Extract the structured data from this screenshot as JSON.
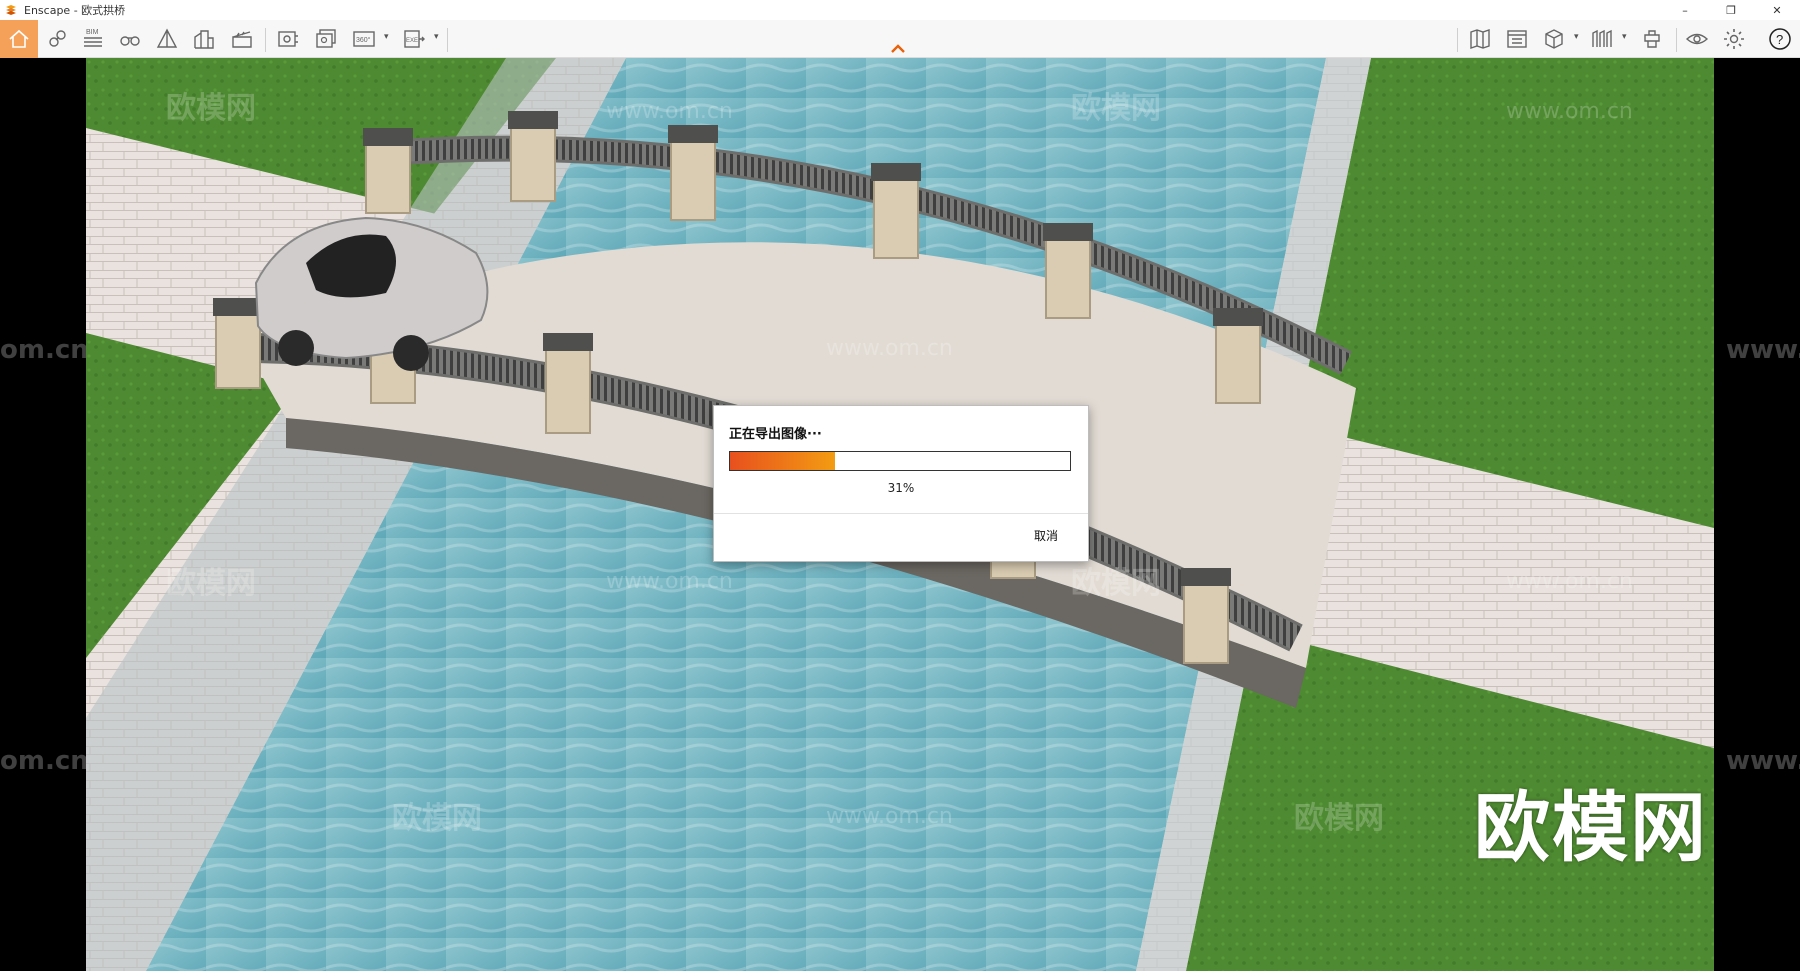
{
  "window": {
    "title": "Enscape - 欧式拱桥"
  },
  "window_controls": {
    "minimize": "–",
    "restore": "❐",
    "close": "✕"
  },
  "toolbar": {
    "left_buttons": [
      "home-icon",
      "location-icon",
      "bim-icon",
      "binoculars-icon",
      "perspective-icon",
      "building-icon",
      "clapper-icon",
      "screenshot-icon",
      "batch-render-icon",
      "panorama-icon",
      "export-icon"
    ],
    "bim_label": "BIM",
    "panorama_label": "360°",
    "export_label": "EXE",
    "right_buttons": [
      "map-icon",
      "asset-library-icon",
      "box-icon",
      "archive-icon",
      "material-icon",
      "view-icon",
      "settings-icon",
      "help-icon"
    ],
    "help_label": "?",
    "accent_color": "#f6a15a"
  },
  "scene": {
    "watermark_text": "欧模网",
    "watermark_url": "www.om.cn",
    "side_watermark_left": "om.cn",
    "side_watermark_right": "www.",
    "brand_watermark": "欧模网"
  },
  "export_dialog": {
    "title": "正在导出图像···",
    "progress": 0.31,
    "progress_text": "31%",
    "cancel_label": "取消"
  }
}
